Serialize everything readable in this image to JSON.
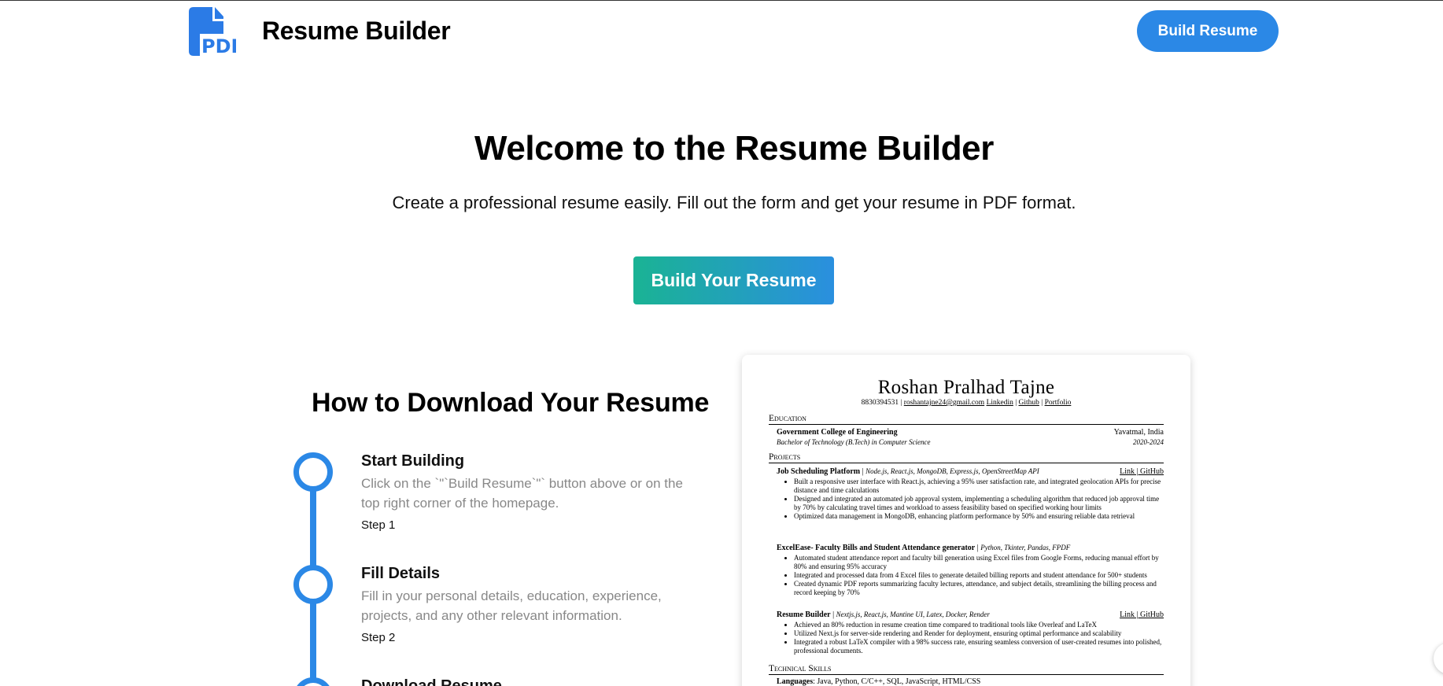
{
  "header": {
    "logo_text": "PDF",
    "brand": "Resume Builder",
    "build_button": "Build Resume"
  },
  "hero": {
    "title": "Welcome to the Resume Builder",
    "subtitle": "Create a professional resume easily. Fill out the form and get your resume in PDF format.",
    "cta": "Build Your Resume"
  },
  "steps": {
    "title": "How to Download Your Resume",
    "items": [
      {
        "title": "Start Building",
        "desc": "Click on the `\"`Build Resume`\"` button above or on the top right corner of the homepage.",
        "num": "Step 1"
      },
      {
        "title": "Fill Details",
        "desc": "Fill in your personal details, education, experience, projects, and any other relevant information.",
        "num": "Step 2"
      },
      {
        "title": "Download Resume",
        "desc": "",
        "num": ""
      }
    ]
  },
  "resume": {
    "name": "Roshan Pralhad Tajne",
    "phone": "8830394531",
    "email": "roshantajne24@gmail.com",
    "links": [
      "Linkedin",
      "Github",
      "Portfolio"
    ],
    "education_heading": "Education",
    "college": "Government College of Engineering",
    "location": "Yavatmal, India",
    "degree": "Bachelor of Technology (B.Tech) in Computer Science",
    "years": "2020-2024",
    "projects_heading": "Projects",
    "projects": [
      {
        "name": "Job Scheduling Platform",
        "stack": "Node.js, React.js, MongoDB, Express.js, OpenStreetMap API",
        "links": "Link | GitHub",
        "bullets": [
          "Built a responsive user interface with React.js, achieving a 95% user satisfaction rate, and integrated geolocation APIs for precise distance and time calculations",
          "Designed and integrated an automated job approval system, implementing a scheduling algorithm that reduced job approval time by 70% by calculating travel times and workload to assess feasibility based on specified working hour limits",
          "Optimized data management in MongoDB, enhancing platform performance by 50% and ensuring reliable data retrieval"
        ]
      },
      {
        "name": "ExcelEase- Faculty Bills and Student Attendance generator",
        "stack": "Python, Tkinter, Pandas, FPDF",
        "links": "",
        "bullets": [
          "Automated student attendance report and faculty bill generation using Excel files from Google Forms, reducing manual effort by 80% and ensuring 95% accuracy",
          "Integrated and processed data from 4 Excel files to generate detailed billing reports and student attendance for 500+ students",
          "Created dynamic PDF reports summarizing faculty lectures, attendance, and subject details, streamlining the billing process and record keeping by 70%"
        ]
      },
      {
        "name": "Resume Builder",
        "stack": "Nextjs.js, React.js, Mantine UI, Latex, Docker, Render",
        "links": "Link | GitHub",
        "bullets": [
          "Achieved an 80% reduction in resume creation time compared to traditional tools like Overleaf and LaTeX",
          "Utilized Next.js for server-side rendering and Render for deployment, ensuring optimal performance and scalability",
          "Integrated a robust LaTeX compiler with a 98% success rate, ensuring seamless conversion of user-created resumes into polished, professional documents."
        ]
      }
    ],
    "skills_heading": "Technical Skills",
    "languages_label": "Languages",
    "languages_value": ": Java, Python, C/C++, SQL, JavaScript, HTML/CSS"
  },
  "colors": {
    "primary": "#2b88e6",
    "cta_gradient_start": "#1ab394",
    "cta_gradient_end": "#2a8fdf"
  }
}
